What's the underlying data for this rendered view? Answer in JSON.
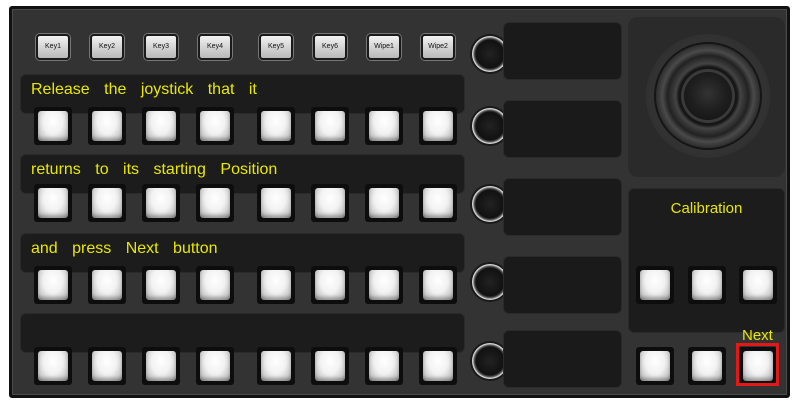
{
  "keys": [
    "Key1",
    "Key2",
    "Key3",
    "Key4",
    "Key5",
    "Key6",
    "Wipe1",
    "Wipe2"
  ],
  "strips": [
    "Release the joystick that it",
    "returns to its starting Position",
    "and press Next button",
    ""
  ],
  "calibration": {
    "title": "Calibration",
    "next_label": "Next"
  },
  "colors": {
    "panel": "#333333",
    "lcd_text": "#e8e800",
    "highlight": "#e31919"
  }
}
